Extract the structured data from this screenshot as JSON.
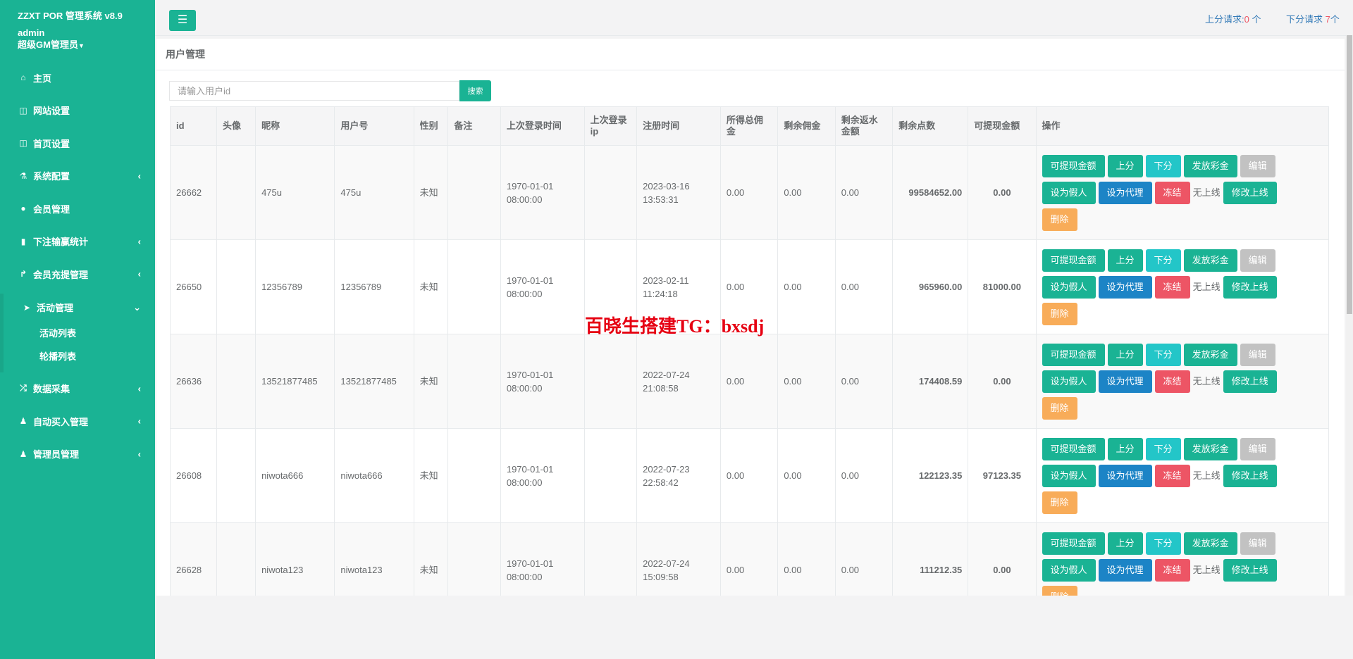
{
  "brand": {
    "title": "ZZXT POR 管理系统 v8.9",
    "user": "admin",
    "role": "超级GM管理员"
  },
  "sidebar": {
    "items": [
      {
        "label": "主页",
        "icon": "home-icon",
        "arrow": ""
      },
      {
        "label": "网站设置",
        "icon": "columns-icon",
        "arrow": ""
      },
      {
        "label": "首页设置",
        "icon": "columns-icon",
        "arrow": ""
      },
      {
        "label": "系统配置",
        "icon": "flask-icon",
        "arrow": "‹"
      },
      {
        "label": "会员管理",
        "icon": "user-icon",
        "arrow": ""
      },
      {
        "label": "下注输赢统计",
        "icon": "bar-chart-icon",
        "arrow": "‹"
      },
      {
        "label": "会员充提管理",
        "icon": "level-up-icon",
        "arrow": "‹"
      },
      {
        "label": "活动管理",
        "icon": "paper-plane-icon",
        "arrow": "⌄"
      }
    ],
    "sub_items": [
      "活动列表",
      "轮播列表"
    ],
    "items_after": [
      {
        "label": "数据采集",
        "icon": "random-icon",
        "arrow": "‹"
      },
      {
        "label": "自动买入管理",
        "icon": "male-icon",
        "arrow": "‹"
      },
      {
        "label": "管理员管理",
        "icon": "male-icon",
        "arrow": "‹"
      }
    ]
  },
  "topbar": {
    "up_label": "上分请求:",
    "up_count": "0",
    "up_unit": " 个",
    "down_label": "下分请求 ",
    "down_count": "7",
    "down_unit": "个"
  },
  "panel": {
    "title": "用户管理"
  },
  "search": {
    "placeholder": "请输入用户id",
    "button": "搜索"
  },
  "table": {
    "headers": [
      "id",
      "头像",
      "昵称",
      "用户号",
      "性别",
      "备注",
      "上次登录时间",
      "上次登录ip",
      "注册时间",
      "所得总佣金",
      "剩余佣金",
      "剩余返水金额",
      "剩余点数",
      "可提现金额",
      "操作"
    ],
    "rows": [
      {
        "id": "26662",
        "avatar": "",
        "nickname": "475u",
        "account": "475u",
        "gender": "未知",
        "remark": "",
        "last_login_date": "1970-01-01",
        "last_login_time": "08:00:00",
        "last_ip": "",
        "reg_date": "2023-03-16",
        "reg_time": "13:53:31",
        "total_commission": "0.00",
        "remain_commission": "0.00",
        "rebate": "0.00",
        "points": "99584652.00",
        "withdrawable": "0.00"
      },
      {
        "id": "26650",
        "avatar": "",
        "nickname": "12356789",
        "account": "12356789",
        "gender": "未知",
        "remark": "",
        "last_login_date": "1970-01-01",
        "last_login_time": "08:00:00",
        "last_ip": "",
        "reg_date": "2023-02-11",
        "reg_time": "11:24:18",
        "total_commission": "0.00",
        "remain_commission": "0.00",
        "rebate": "0.00",
        "points": "965960.00",
        "withdrawable": "81000.00"
      },
      {
        "id": "26636",
        "avatar": "",
        "nickname": "13521877485",
        "account": "13521877485",
        "gender": "未知",
        "remark": "",
        "last_login_date": "1970-01-01",
        "last_login_time": "08:00:00",
        "last_ip": "",
        "reg_date": "2022-07-24",
        "reg_time": "21:08:58",
        "total_commission": "0.00",
        "remain_commission": "0.00",
        "rebate": "0.00",
        "points": "174408.59",
        "withdrawable": "0.00"
      },
      {
        "id": "26608",
        "avatar": "",
        "nickname": "niwota666",
        "account": "niwota666",
        "gender": "未知",
        "remark": "",
        "last_login_date": "1970-01-01",
        "last_login_time": "08:00:00",
        "last_ip": "",
        "reg_date": "2022-07-23",
        "reg_time": "22:58:42",
        "total_commission": "0.00",
        "remain_commission": "0.00",
        "rebate": "0.00",
        "points": "122123.35",
        "withdrawable": "97123.35"
      },
      {
        "id": "26628",
        "avatar": "",
        "nickname": "niwota123",
        "account": "niwota123",
        "gender": "未知",
        "remark": "",
        "last_login_date": "1970-01-01",
        "last_login_time": "08:00:00",
        "last_ip": "",
        "reg_date": "2022-07-24",
        "reg_time": "15:09:58",
        "total_commission": "0.00",
        "remain_commission": "0.00",
        "rebate": "0.00",
        "points": "111212.35",
        "withdrawable": "0.00"
      }
    ],
    "actions": [
      {
        "label": "可提现金额",
        "style": "primary",
        "name": "withdrawable-button"
      },
      {
        "label": "上分",
        "style": "primary",
        "name": "add-points-button"
      },
      {
        "label": "下分",
        "style": "info",
        "name": "reduce-points-button"
      },
      {
        "label": "发放彩金",
        "style": "primary",
        "name": "issue-bonus-button"
      },
      {
        "label": "编辑",
        "style": "default",
        "name": "edit-button"
      },
      {
        "label": "设为假人",
        "style": "primary",
        "name": "set-fake-button"
      },
      {
        "label": "设为代理",
        "style": "blue",
        "name": "set-agent-button"
      },
      {
        "label": "冻结",
        "style": "danger",
        "name": "freeze-button"
      },
      {
        "label": "无上线",
        "style": "text",
        "name": "no-upline-text"
      },
      {
        "label": "修改上线",
        "style": "primary",
        "name": "change-upline-button"
      },
      {
        "label": "删除",
        "style": "warning",
        "name": "delete-button"
      }
    ]
  },
  "watermark": "百晓生搭建TG：bxsdj"
}
